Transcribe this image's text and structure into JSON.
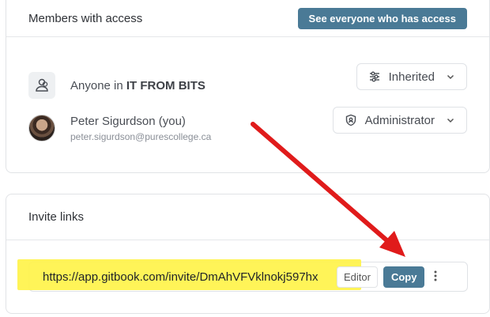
{
  "members": {
    "title": "Members with access",
    "see_everyone_label": "See everyone who has access",
    "rows": [
      {
        "name_prefix": "Anyone in ",
        "name_strong": "IT FROM BITS",
        "email": "",
        "role": "Inherited",
        "role_icon": "sliders-icon",
        "avatar": "group-icon"
      },
      {
        "name_prefix": "Peter Sigurdson (you)",
        "name_strong": "",
        "email": "peter.sigurdson@purescollege.ca",
        "role": "Administrator",
        "role_icon": "shield-icon",
        "avatar": "user-photo"
      }
    ]
  },
  "invite": {
    "title": "Invite links",
    "url": "https://app.gitbook.com/invite/DmAhVFVklnokj597hx",
    "role_label": "Editor",
    "copy_label": "Copy",
    "more_icon": "more-vertical-icon"
  },
  "annotation": {
    "arrow_color": "#e01b1b",
    "highlight_color": "#fff34a"
  }
}
